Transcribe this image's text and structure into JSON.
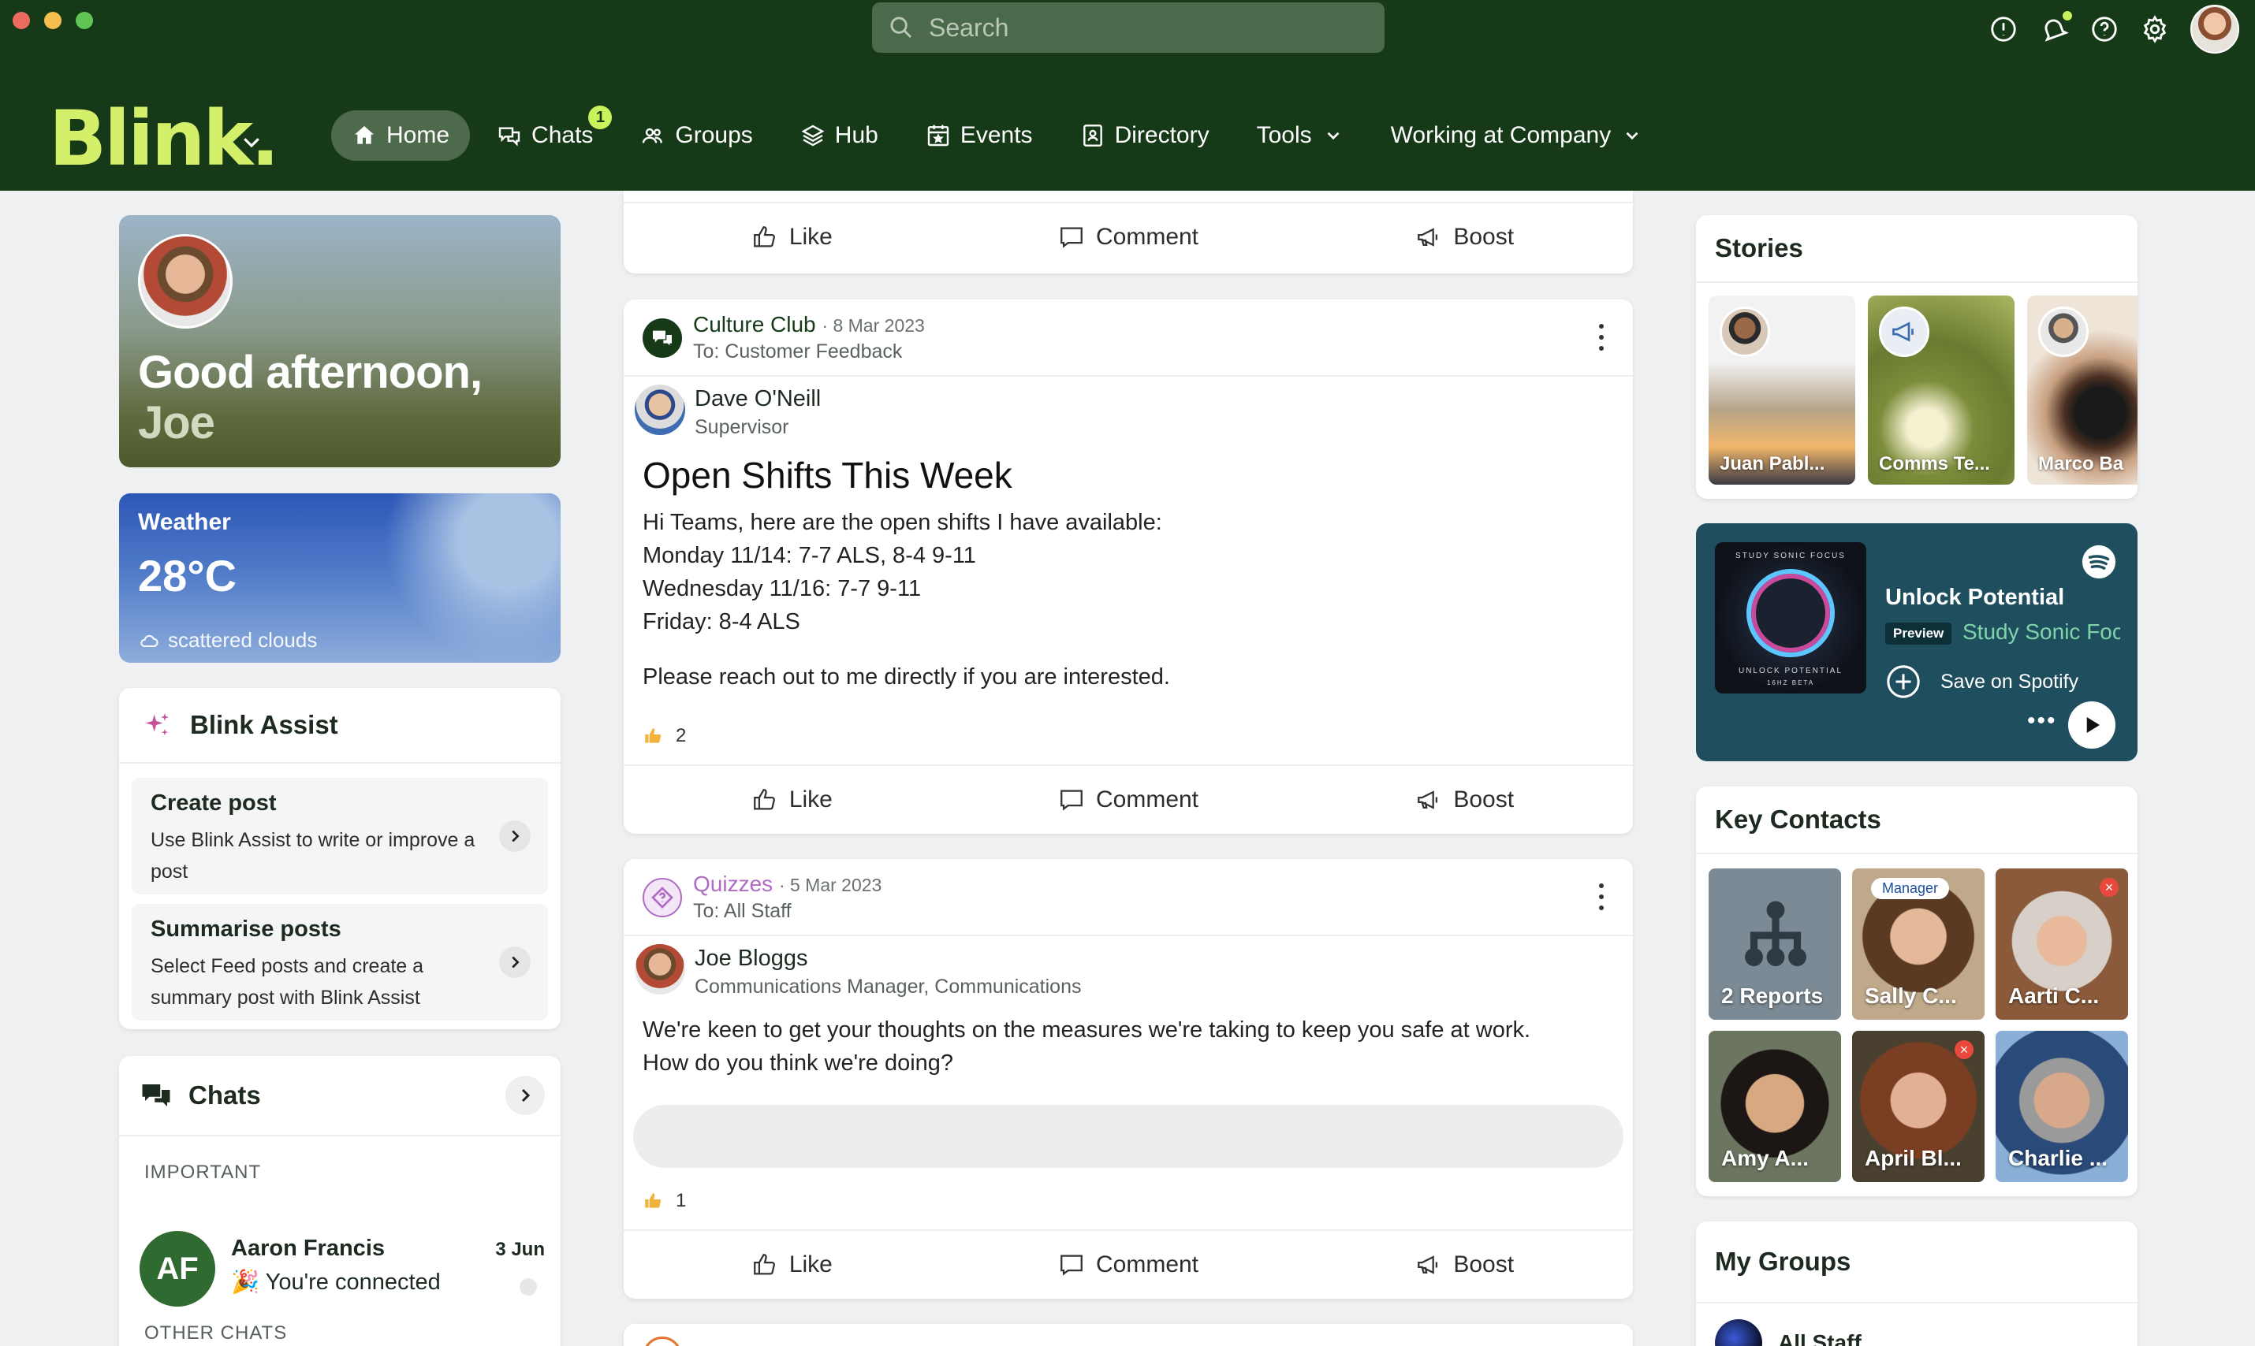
{
  "search": {
    "placeholder": "Search"
  },
  "brand": {
    "logo": "Blink."
  },
  "nav": {
    "items": [
      {
        "label": "Home",
        "icon": "home-icon",
        "active": true
      },
      {
        "label": "Chats",
        "icon": "chat-icon",
        "badge": "1"
      },
      {
        "label": "Groups",
        "icon": "groups-icon"
      },
      {
        "label": "Hub",
        "icon": "layers-icon"
      },
      {
        "label": "Events",
        "icon": "calendar-icon"
      },
      {
        "label": "Directory",
        "icon": "directory-icon"
      },
      {
        "label": "Tools",
        "icon": "tools",
        "dropdown": true
      },
      {
        "label": "Working at Company",
        "dropdown": true
      }
    ]
  },
  "greeting": {
    "line1": "Good afternoon,",
    "name": "Joe"
  },
  "weather": {
    "title": "Weather",
    "temp": "28°C",
    "desc": "scattered clouds"
  },
  "assist": {
    "title": "Blink Assist",
    "items": [
      {
        "title": "Create post",
        "desc": "Use Blink Assist to write or improve a post"
      },
      {
        "title": "Summarise posts",
        "desc": "Select Feed posts and create a summary post with Blink Assist"
      }
    ]
  },
  "chats": {
    "title": "Chats",
    "important_label": "IMPORTANT",
    "other_label": "OTHER CHATS",
    "items": [
      {
        "initials": "AF",
        "name": "Aaron Francis",
        "message": "🎉 You're connected",
        "date": "3 Jun"
      }
    ]
  },
  "actions": {
    "like": "Like",
    "comment": "Comment",
    "boost": "Boost"
  },
  "posts": [
    {
      "group": "Culture Club",
      "date": "· 8 Mar 2023",
      "to": "To: Customer Feedback",
      "author": "Dave O'Neill",
      "role": "Supervisor",
      "title": "Open Shifts This Week",
      "body": [
        "Hi Teams, here are the open shifts I have available:",
        "Monday 11/14: 7-7 ALS, 8-4 9-11",
        "Wednesday 11/16: 7-7 9-11",
        "Friday: 8-4 ALS",
        "Please reach out to me directly if you are interested."
      ],
      "likes": "2",
      "color": "#163a17"
    },
    {
      "group": "Quizzes",
      "date": "· 5 Mar 2023",
      "to": "To: All Staff",
      "author": "Joe Bloggs",
      "role": "Communications Manager, Communications",
      "body": [
        "We're keen to get your thoughts on the measures we're taking to keep you safe at work.",
        "How do you think we're doing?"
      ],
      "likes": "1",
      "color": "#b06bc4"
    }
  ],
  "stories": {
    "title": "Stories",
    "items": [
      {
        "label": "Juan Pabl..."
      },
      {
        "label": "Comms Te..."
      },
      {
        "label": "Marco Ba"
      }
    ]
  },
  "spotify": {
    "title": "Unlock Potential",
    "preview": "Preview",
    "subtitle": "Study Sonic Foc",
    "save": "Save on Spotify",
    "more": "•••",
    "cover_top": "STUDY SONIC FOCUS",
    "cover_bottom": "UNLOCK POTENTIAL",
    "cover_sub": "16HZ BETA"
  },
  "contacts": {
    "title": "Key Contacts",
    "items": [
      {
        "label": "2 Reports"
      },
      {
        "label": "Sally C...",
        "tag": "Manager"
      },
      {
        "label": "Aarti C...",
        "remove": "×"
      },
      {
        "label": "Amy A..."
      },
      {
        "label": "April Bl...",
        "remove": "×"
      },
      {
        "label": "Charlie ..."
      }
    ]
  },
  "groups": {
    "title": "My Groups",
    "items": [
      {
        "label": "All Staff"
      }
    ]
  },
  "colors": {
    "topbar": "#163a17",
    "accent": "#c9f25c",
    "logo": "#d4f06a"
  }
}
